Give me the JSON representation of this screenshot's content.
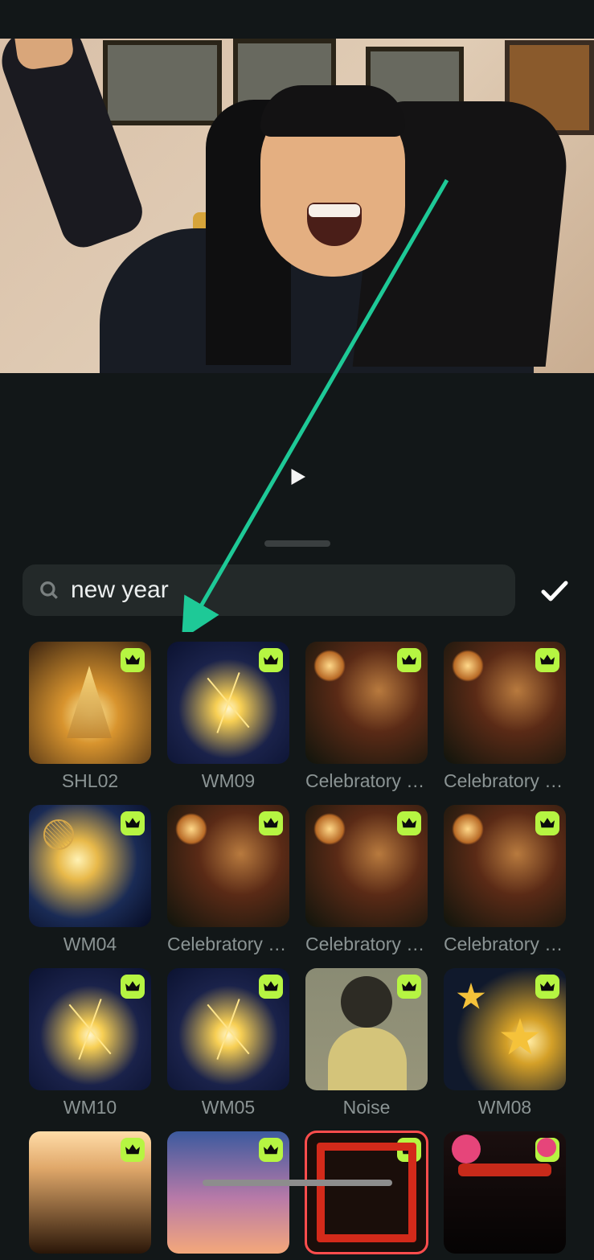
{
  "search": {
    "value": "new year",
    "placeholder": "Search"
  },
  "effects": [
    {
      "label": "SHL02",
      "thumb_class": "th-shl02",
      "premium": true,
      "selected": false
    },
    {
      "label": "WM09",
      "thumb_class": "th-sparkler",
      "premium": true,
      "selected": false
    },
    {
      "label": "Celebratory Vibes",
      "thumb_class": "th-celeb",
      "premium": true,
      "selected": false
    },
    {
      "label": "Celebratory Vibes",
      "thumb_class": "th-celeb",
      "premium": true,
      "selected": false
    },
    {
      "label": "WM04",
      "thumb_class": "th-wm04",
      "premium": true,
      "selected": false
    },
    {
      "label": "Celebratory Vibes",
      "thumb_class": "th-celeb",
      "premium": true,
      "selected": false
    },
    {
      "label": "Celebratory Vibes",
      "thumb_class": "th-celeb",
      "premium": true,
      "selected": false
    },
    {
      "label": "Celebratory Vibes",
      "thumb_class": "th-celeb",
      "premium": true,
      "selected": false
    },
    {
      "label": "WM10",
      "thumb_class": "th-sparkler",
      "premium": true,
      "selected": false
    },
    {
      "label": "WM05",
      "thumb_class": "th-sparkler",
      "premium": true,
      "selected": false
    },
    {
      "label": "Noise",
      "thumb_class": "th-noise",
      "premium": true,
      "selected": false
    },
    {
      "label": "WM08",
      "thumb_class": "th-wm08",
      "premium": true,
      "selected": false
    },
    {
      "label": "",
      "thumb_class": "th-city",
      "premium": true,
      "selected": false
    },
    {
      "label": "",
      "thumb_class": "th-sky",
      "premium": true,
      "selected": false
    },
    {
      "label": "",
      "thumb_class": "th-torii",
      "premium": true,
      "selected": true
    },
    {
      "label": "",
      "thumb_class": "th-torii2",
      "premium": true,
      "selected": false
    }
  ],
  "annotation_arrow": {
    "from_desc": "preview-area",
    "to_desc": "effect-item-WM09",
    "color": "#1ec997"
  }
}
